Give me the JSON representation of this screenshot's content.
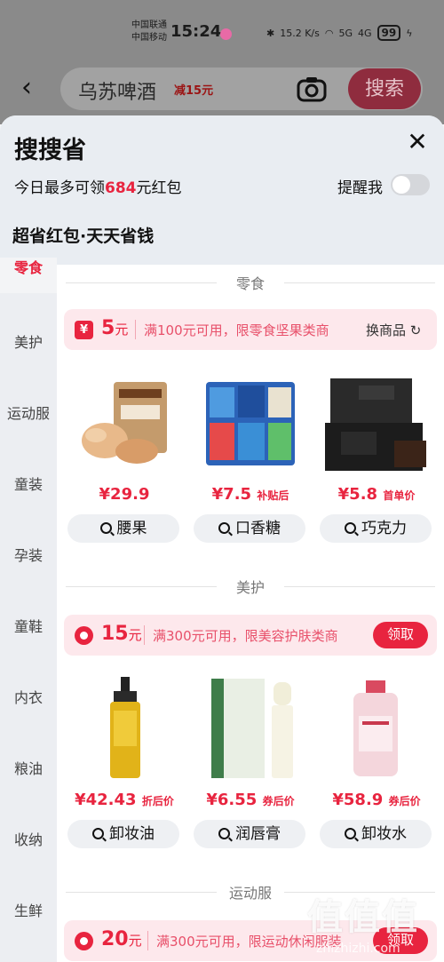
{
  "status_bar": {
    "carrier1": "中国联通",
    "carrier2": "中国移动",
    "time": "15:24",
    "speed": "15.2 K/s",
    "net1": "5G",
    "net2": "4G",
    "battery": "99"
  },
  "search": {
    "query": "乌苏啤酒",
    "query_tag": "减15元",
    "button_label": "搜索"
  },
  "sheet": {
    "title": "搜搜省",
    "quota_prefix": "今日最多可领",
    "quota_amount": "684",
    "quota_suffix": "元红包",
    "remind_label": "提醒我",
    "remind_on": false,
    "slogan": "超省红包·天天省钱"
  },
  "categories": [
    "零食",
    "美护",
    "运动服",
    "童装",
    "孕装",
    "童鞋",
    "内衣",
    "粮油",
    "收纳",
    "生鲜"
  ],
  "active_category": "零食",
  "sections": [
    {
      "title": "零食",
      "coupon": {
        "amount": "5",
        "unit": "元",
        "desc": "满100元可用，限零食坚果类商",
        "action": "换商品"
      },
      "products": [
        {
          "price": "¥29.9",
          "price_note": "",
          "keyword": "腰果"
        },
        {
          "price": "¥7.5",
          "price_note": "补贴后",
          "keyword": "口香糖"
        },
        {
          "price": "¥5.8",
          "price_note": "首单价",
          "keyword": "巧克力"
        }
      ]
    },
    {
      "title": "美护",
      "coupon": {
        "amount": "15",
        "unit": "元",
        "desc": "满300元可用，限美容护肤类商",
        "action": "领取"
      },
      "products": [
        {
          "price": "¥42.43",
          "price_note": "折后价",
          "keyword": "卸妆油"
        },
        {
          "price": "¥6.55",
          "price_note": "券后价",
          "keyword": "润唇膏"
        },
        {
          "price": "¥58.9",
          "price_note": "券后价",
          "keyword": "卸妆水"
        }
      ]
    },
    {
      "title": "运动服",
      "coupon": {
        "amount": "20",
        "unit": "元",
        "desc": "满300元可用，限运动休闲服装",
        "action": "领取"
      },
      "products": []
    }
  ],
  "watermark": {
    "main": "值值值",
    "sub": "zhizhizhi.com"
  },
  "colors": {
    "accent": "#e8243f",
    "coupon_bg": "#fde8ec",
    "sheet_bg": "#e9edf2"
  },
  "icons": [
    "back-arrow-icon",
    "camera-icon",
    "close-icon",
    "search-icon",
    "refresh-icon",
    "coupon-yen-icon",
    "coupon-dot-icon"
  ]
}
